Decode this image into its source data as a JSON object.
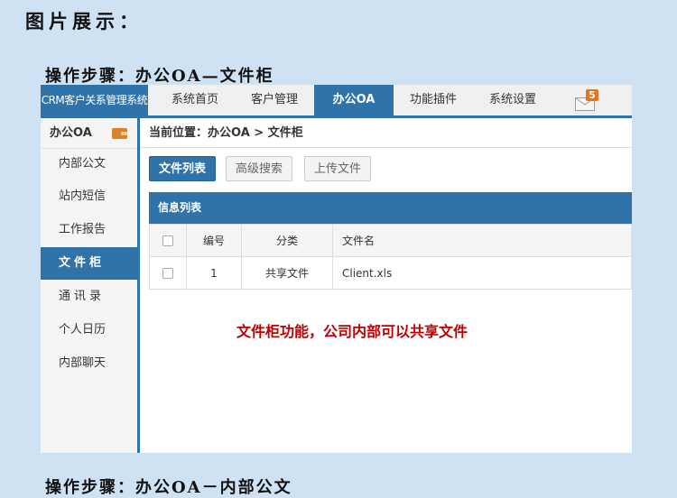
{
  "page": {
    "heading": "图片展示：",
    "step_title": "操作步骤：办公OA—文件柜",
    "next_step_title": "操作步骤：办公OA－内部公文"
  },
  "colors": {
    "accent": "#2f73a8",
    "badge": "#e8711b",
    "annotation": "#c00000"
  },
  "app": {
    "brand": "CRM客户关系管理系统",
    "nav": [
      {
        "label": "系统首页",
        "active": false
      },
      {
        "label": "客户管理",
        "active": false
      },
      {
        "label": "办公OA",
        "active": true
      },
      {
        "label": "功能插件",
        "active": false
      },
      {
        "label": "系统设置",
        "active": false
      }
    ],
    "mail": {
      "icon": "mail-icon",
      "count": "5"
    },
    "sidebar": {
      "title": "办公OA",
      "title_icon": "wallet-icon",
      "items": [
        {
          "label": "内部公文",
          "active": false
        },
        {
          "label": "站内短信",
          "active": false
        },
        {
          "label": "工作报告",
          "active": false
        },
        {
          "label": "文件柜",
          "active": true
        },
        {
          "label": "通讯录",
          "active": false
        },
        {
          "label": "个人日历",
          "active": false
        },
        {
          "label": "内部聊天",
          "active": false
        }
      ]
    },
    "breadcrumb": "当前位置：办公OA > 文件柜",
    "buttons": {
      "list": "文件列表",
      "search": "高级搜索",
      "upload": "上传文件"
    },
    "table": {
      "title": "信息列表",
      "headers": {
        "id": "编号",
        "category": "分类",
        "name": "文件名"
      },
      "rows": [
        {
          "id": "1",
          "category": "共享文件",
          "name": "Client.xls",
          "checked": false
        }
      ]
    },
    "annotation": "文件柜功能，公司内部可以共享文件"
  }
}
